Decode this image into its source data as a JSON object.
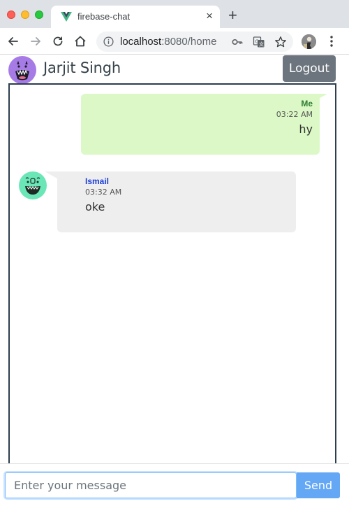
{
  "browser": {
    "tab_title": "firebase-chat",
    "tab_close": "×",
    "new_tab": "+",
    "url_host": "localhost",
    "url_rest": ":8080/home"
  },
  "icons": {
    "back": "arrow-left-icon",
    "forward": "arrow-right-icon",
    "reload": "reload-icon",
    "home": "home-icon",
    "site_info": "info-icon",
    "passwords": "key-icon",
    "translate": "translate-icon",
    "bookmark": "star-icon",
    "profile": "profile-avatar-icon",
    "menu": "kebab-menu-icon"
  },
  "header": {
    "user_name": "Jarjit Singh",
    "logout_label": "Logout"
  },
  "messages": [
    {
      "sender": "Me",
      "time": "03:22 AM",
      "text": "hy",
      "side": "right"
    },
    {
      "sender": "Ismail",
      "time": "03:32 AM",
      "text": "oke",
      "side": "left"
    }
  ],
  "composer": {
    "placeholder": "Enter your message",
    "value": "",
    "send_label": "Send"
  },
  "colors": {
    "own_bubble": "#dcf8c6",
    "other_bubble": "#eeeeee",
    "own_sender": "#2e7d32",
    "other_sender": "#1b3ddb",
    "logout_bg": "#6c757d",
    "send_bg": "#63a7f5",
    "header_avatar": "#a77be6",
    "other_avatar": "#6ae6b7"
  }
}
